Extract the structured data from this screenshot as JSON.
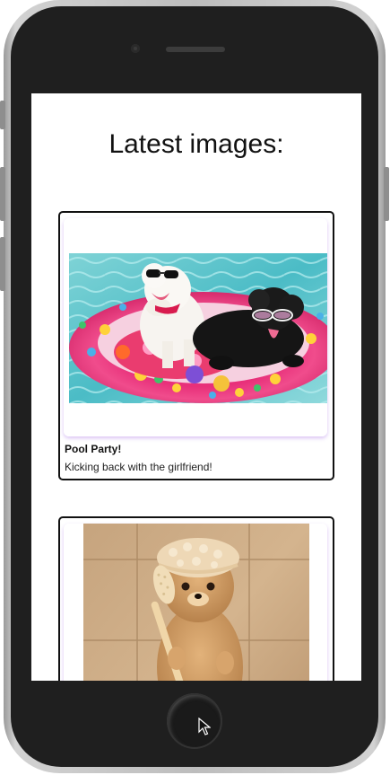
{
  "page": {
    "title": "Latest images:"
  },
  "posts": [
    {
      "title": "Pool Party!",
      "caption": "Kicking back with the girlfriend!",
      "image": "poodles-in-pool-float-photo"
    },
    {
      "title": "",
      "caption": "",
      "image": "pomeranian-shower-cap-photo"
    }
  ],
  "device": {
    "frame_color": "#1f1f1f",
    "cursor": "arrow-cursor-icon"
  }
}
